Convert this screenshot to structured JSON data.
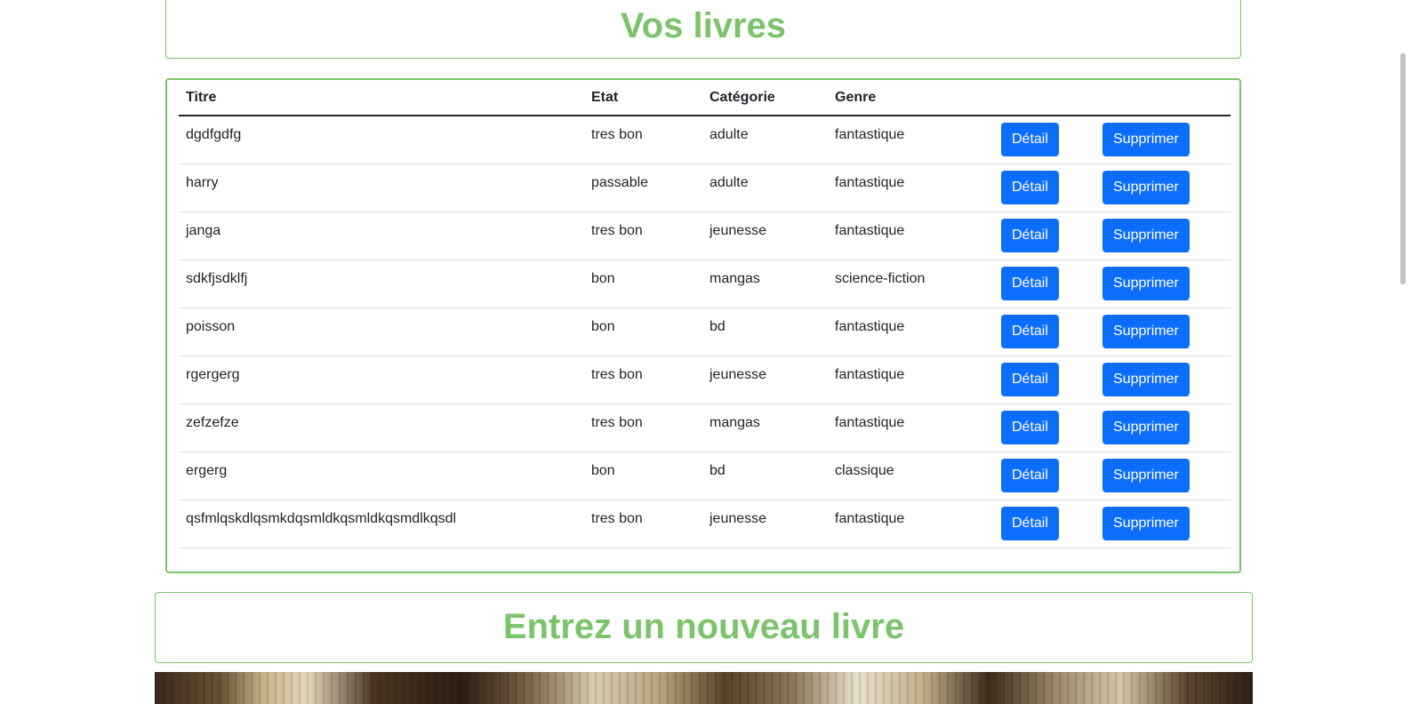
{
  "header": {
    "title": "Vos livres"
  },
  "table": {
    "columns": {
      "titre": "Titre",
      "etat": "Etat",
      "categorie": "Catégorie",
      "genre": "Genre"
    },
    "detail_label": "Détail",
    "delete_label": "Supprimer",
    "rows": [
      {
        "titre": "dgdfgdfg",
        "etat": "tres bon",
        "categorie": "adulte",
        "genre": "fantastique"
      },
      {
        "titre": "harry",
        "etat": "passable",
        "categorie": "adulte",
        "genre": "fantastique"
      },
      {
        "titre": "janga",
        "etat": "tres bon",
        "categorie": "jeunesse",
        "genre": "fantastique"
      },
      {
        "titre": "sdkfjsdklfj",
        "etat": "bon",
        "categorie": "mangas",
        "genre": "science-fiction"
      },
      {
        "titre": "poisson",
        "etat": "bon",
        "categorie": "bd",
        "genre": "fantastique"
      },
      {
        "titre": "rgergerg",
        "etat": "tres bon",
        "categorie": "jeunesse",
        "genre": "fantastique"
      },
      {
        "titre": "zefzefze",
        "etat": "tres bon",
        "categorie": "mangas",
        "genre": "fantastique"
      },
      {
        "titre": "ergerg",
        "etat": "bon",
        "categorie": "bd",
        "genre": "classique"
      },
      {
        "titre": "qsfmlqskdlqsmkdqsmldkqsmldkqsmdlkqsdl",
        "etat": "tres bon",
        "categorie": "jeunesse",
        "genre": "fantastique"
      }
    ]
  },
  "new_book": {
    "title": "Entrez un nouveau livre"
  },
  "colors": {
    "accent_green": "#7dc36b",
    "button_blue": "#0d6efd"
  }
}
